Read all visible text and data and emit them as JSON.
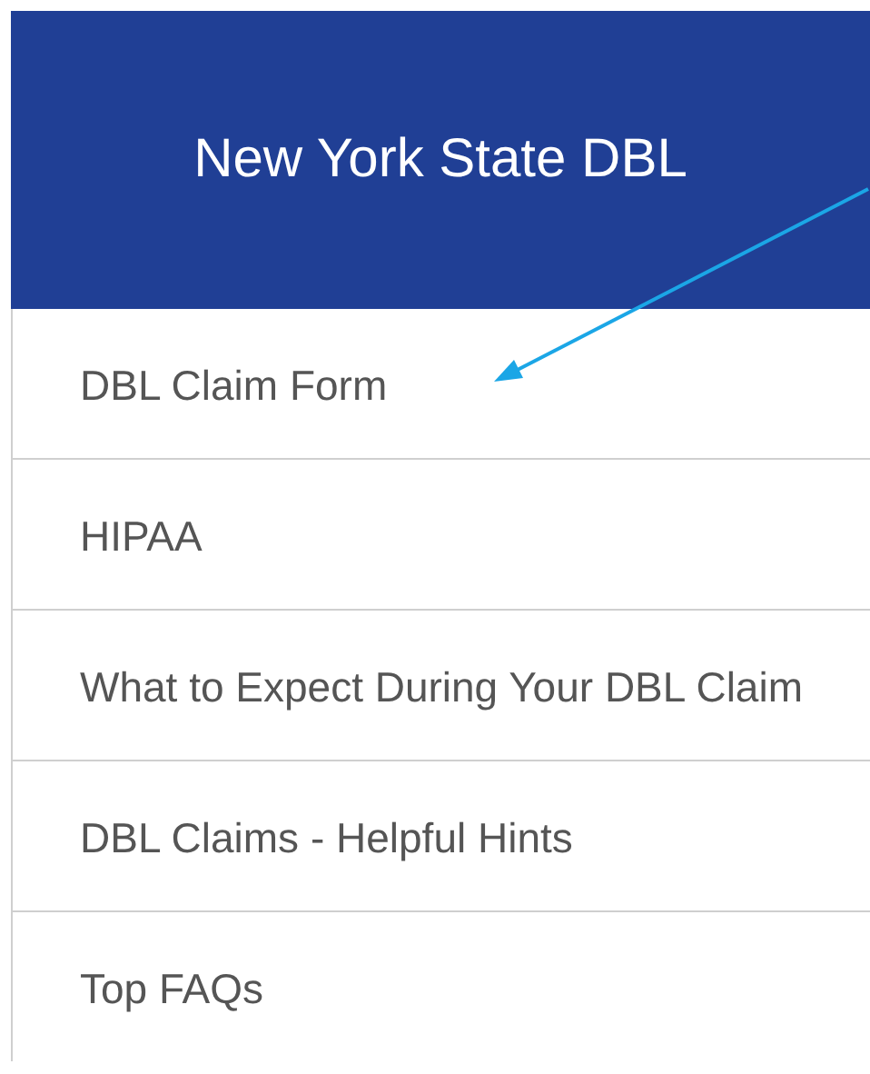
{
  "header": {
    "title": "New York State DBL"
  },
  "menu": [
    {
      "label": "DBL Claim Form"
    },
    {
      "label": "HIPAA"
    },
    {
      "label": "What to Expect During Your DBL Claim"
    },
    {
      "label": "DBL Claims - Helpful Hints"
    },
    {
      "label": "Top FAQs"
    }
  ]
}
